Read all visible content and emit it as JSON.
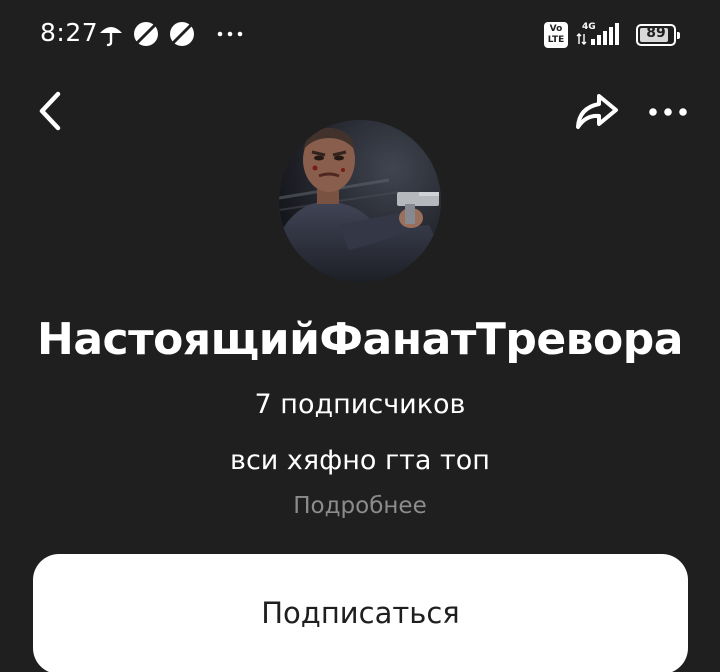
{
  "status_bar": {
    "time": "8:27",
    "left_icons": [
      "umbrella-icon",
      "blocked-circle-icon",
      "blocked-circle-icon",
      "more-dots-icon"
    ],
    "volte_label": "Vo LTE",
    "network_label": "4G",
    "battery_level": "89",
    "battery_fraction": 0.89
  },
  "header": {
    "back_icon": "chevron-left-icon",
    "share_icon": "share-icon",
    "more_icon": "more-dots-icon"
  },
  "channel": {
    "name": "НастоящийФанатТревора",
    "subscribers": "7 подписчиков",
    "description": "вси хяфно гта топ",
    "more_label": "Подробнее"
  },
  "subscribe_button": {
    "label": "Подписаться"
  },
  "colors": {
    "background": "#1f1f20",
    "text": "#ffffff",
    "muted": "#8c8c8c",
    "button_bg": "#ffffff",
    "button_text": "#1f1f20"
  }
}
